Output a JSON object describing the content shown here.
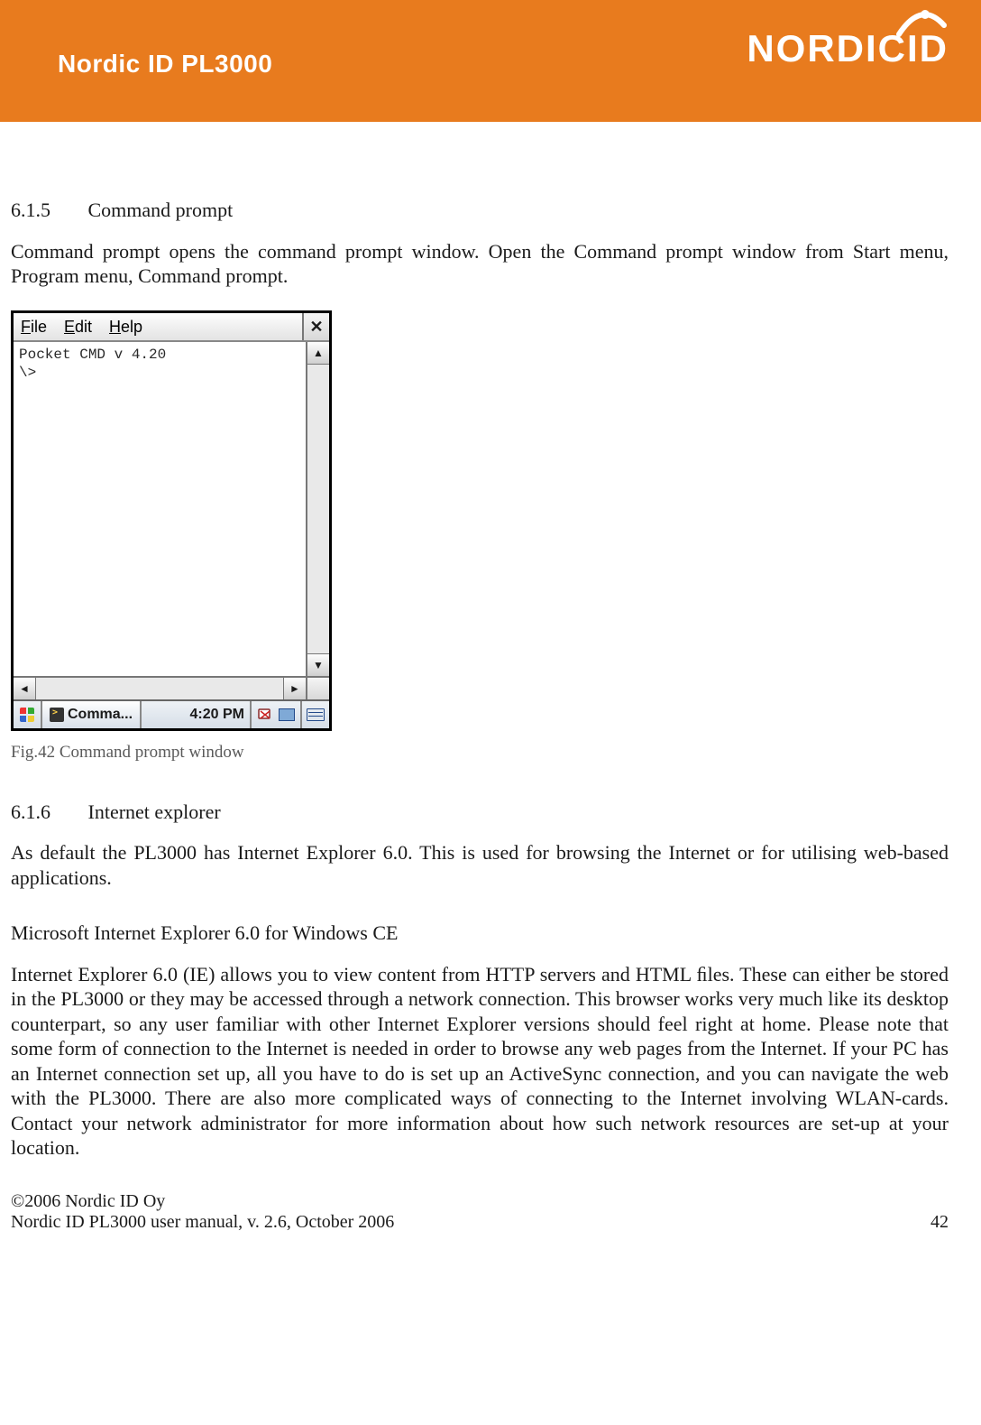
{
  "header": {
    "title": "Nordic ID PL3000",
    "brand": "NORDICID"
  },
  "sections": {
    "s615": {
      "num": "6.1.5",
      "title": "Command prompt",
      "para": "Command prompt opens the command prompt window. Open the Command prompt window from Start menu, Program menu, Command prompt."
    },
    "figcaption": "Fig.42 Command prompt window",
    "s616": {
      "num": "6.1.6",
      "title": "Internet explorer",
      "para": "As default the PL3000 has Internet Explorer 6.0. This is used for browsing the Internet or for utilising web-based applications."
    },
    "msie": {
      "heading": "Microsoft Internet Explorer 6.0 for Windows CE",
      "para": "Internet Explorer 6.0 (IE) allows you to view content from HTTP servers and HTML ﬁles. These can either be stored in the PL3000 or they may be accessed through a network connection. This browser works very much like its desktop counterpart, so any user familiar with other Internet Explorer versions should feel right at home. Please note that some form of connection to the Internet is needed in order to browse any web pages from the Internet. If your PC has an Internet connection set up, all you have to do is set up an ActiveSync connection, and you can navigate the web with the PL3000. There are also more complicated ways of connecting to the Internet involving WLAN-cards. Contact your network administrator for more information about how such network resources are set-up at your location."
    }
  },
  "ce_window": {
    "menu": {
      "file": "File",
      "edit": "Edit",
      "help": "Help"
    },
    "console_line1": "Pocket CMD v 4.20",
    "console_line2": "\\>",
    "task_label": "Comma...",
    "clock": "4:20 PM"
  },
  "footer": {
    "copyright": "©2006 Nordic ID Oy",
    "docline": "Nordic ID PL3000 user manual, v. 2.6, October 2006",
    "page": "42"
  }
}
